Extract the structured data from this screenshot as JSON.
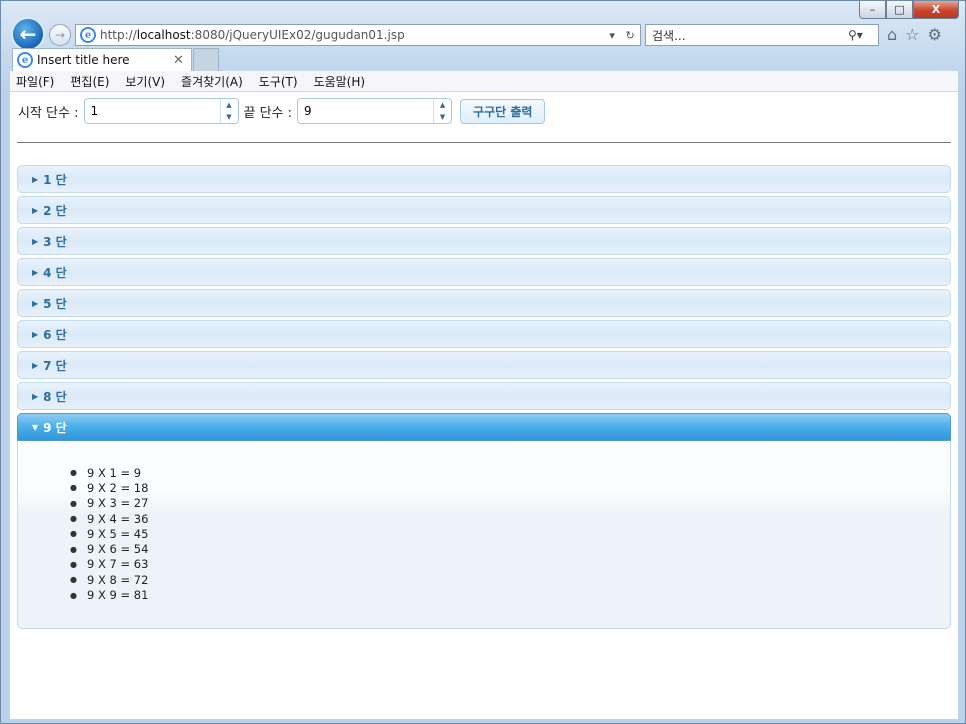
{
  "window": {
    "minimize": "–",
    "maximize": "□",
    "close": "X"
  },
  "browser": {
    "url_prefix": "http://",
    "url_host": "localhost",
    "url_rest": ":8080/jQueryUIEx02/gugudan01.jsp",
    "search_placeholder": "검색...",
    "tab_title": "Insert title here"
  },
  "menu": [
    "파일(F)",
    "편집(E)",
    "보기(V)",
    "즐겨찾기(A)",
    "도구(T)",
    "도움말(H)"
  ],
  "form": {
    "start_label": "시작 단수 :",
    "start_value": "1",
    "end_label": "끝 단수 :",
    "end_value": "9",
    "print_button": "구구단 출력"
  },
  "accordion": {
    "sections": [
      "1 단",
      "2 단",
      "3 단",
      "4 단",
      "5 단",
      "6 단",
      "7 단",
      "8 단",
      "9 단"
    ],
    "active_index": 8,
    "active_items": [
      "9 X 1 = 9",
      "9 X 2 = 18",
      "9 X 3 = 27",
      "9 X 4 = 36",
      "9 X 5 = 45",
      "9 X 6 = 54",
      "9 X 7 = 63",
      "9 X 8 = 72",
      "9 X 9 = 81"
    ]
  }
}
